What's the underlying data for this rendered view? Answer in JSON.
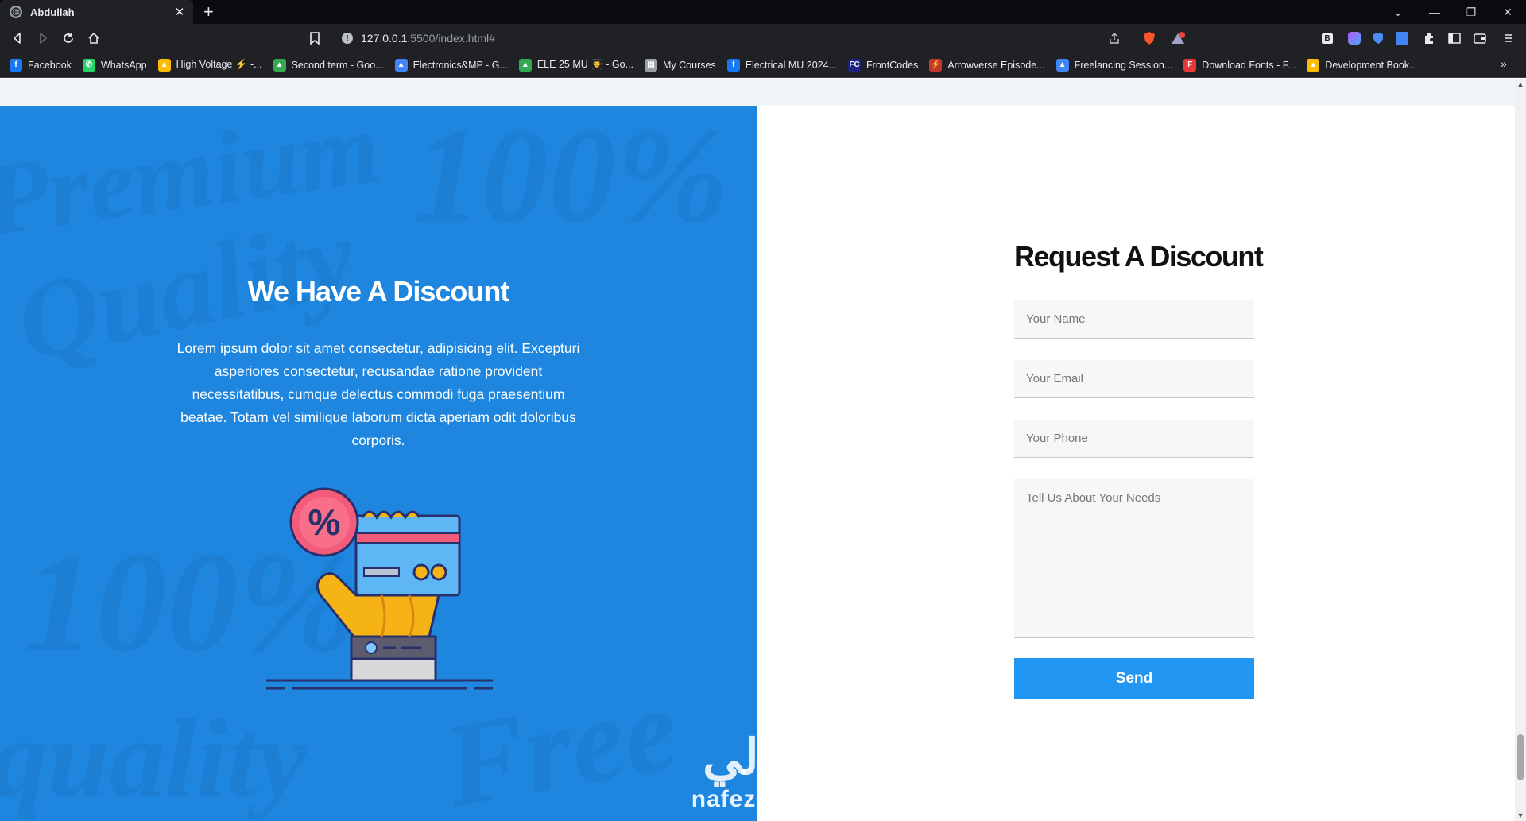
{
  "browser": {
    "tab": {
      "title": "Abdullah",
      "close_glyph": "✕"
    },
    "new_tab_glyph": "+",
    "url": {
      "host": "127.0.0.1",
      "rest": ":5500/index.html#"
    },
    "bookmarks": [
      {
        "label": "Facebook",
        "icon": "facebook-icon",
        "color": "#1877f2",
        "glyph": "f"
      },
      {
        "label": "WhatsApp",
        "icon": "whatsapp-icon",
        "color": "#25d366",
        "glyph": "✆"
      },
      {
        "label": "High Voltage ⚡ -...",
        "icon": "drive-icon",
        "color": "#fbbc04",
        "glyph": "▲"
      },
      {
        "label": "Second term - Goo...",
        "icon": "drive-icon",
        "color": "#34a853",
        "glyph": "▲"
      },
      {
        "label": "Electronics&MP - G...",
        "icon": "drive-icon",
        "color": "#4285f4",
        "glyph": "▲"
      },
      {
        "label": "ELE 25 MU 👨‍🎓 - Go...",
        "icon": "drive-icon",
        "color": "#34a853",
        "glyph": "▲"
      },
      {
        "label": "My Courses",
        "icon": "courses-icon",
        "color": "#9aa0a6",
        "glyph": "▤"
      },
      {
        "label": "Electrical MU 2024...",
        "icon": "facebook-icon",
        "color": "#1877f2",
        "glyph": "f"
      },
      {
        "label": "FrontCodes",
        "icon": "frontcodes-icon",
        "color": "#1a237e",
        "glyph": "FC"
      },
      {
        "label": "Arrowverse Episode...",
        "icon": "arrowverse-icon",
        "color": "#c0392b",
        "glyph": "⚡"
      },
      {
        "label": "Freelancing Session...",
        "icon": "drive-icon",
        "color": "#4285f4",
        "glyph": "▲"
      },
      {
        "label": "Download Fonts - F...",
        "icon": "fonts-icon",
        "color": "#e53935",
        "glyph": "F"
      },
      {
        "label": "Development Book...",
        "icon": "drive-icon",
        "color": "#fbbc04",
        "glyph": "▲"
      }
    ]
  },
  "page": {
    "left": {
      "title": "We Have A Discount",
      "text": "Lorem ipsum dolor sit amet consectetur, adipisicing elit. Excepturi asperiores consectetur, recusandae ratione provident necessitatibus, cumque delectus commodi fuga praesentium beatae. Totam vel similique laborum dicta aperiam odit doloribus corporis.",
      "accent_color": "#1e86df"
    },
    "form": {
      "title": "Request A Discount",
      "name_placeholder": "Your Name",
      "email_placeholder": "Your Email",
      "phone_placeholder": "Your Phone",
      "needs_placeholder": "Tell Us About Your Needs",
      "send_label": "Send",
      "button_color": "#2196f3"
    },
    "watermark": {
      "arabic": "نفذلي",
      "latin": "nafezly.com"
    }
  }
}
